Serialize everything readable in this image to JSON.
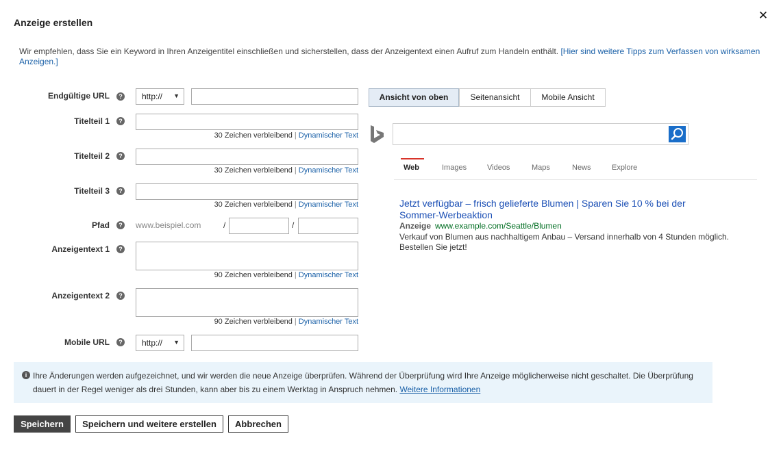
{
  "dialog": {
    "title": "Anzeige erstellen",
    "intro_text": "Wir empfehlen, dass Sie ein Keyword in Ihren Anzeigentitel einschließen und sicherstellen, dass der Anzeigentext einen Aufruf zum Handeln enthält. ",
    "intro_link": "[Hier sind weitere Tipps zum Verfassen von wirksamen Anzeigen.]"
  },
  "form": {
    "final_url": {
      "label": "Endgültige URL",
      "protocol": "http://",
      "value": ""
    },
    "headline1": {
      "label": "Titelteil 1",
      "value": "",
      "counter": "30 Zeichen verbleibend"
    },
    "headline2": {
      "label": "Titelteil 2",
      "value": "",
      "counter": "30 Zeichen verbleibend"
    },
    "headline3": {
      "label": "Titelteil 3",
      "value": "",
      "counter": "30 Zeichen verbleibend"
    },
    "path": {
      "label": "Pfad",
      "prefix": "www.beispiel.com",
      "slash": "/",
      "path1": "",
      "path2": ""
    },
    "desc1": {
      "label": "Anzeigentext 1",
      "value": "",
      "counter": "90 Zeichen verbleibend"
    },
    "desc2": {
      "label": "Anzeigentext 2",
      "value": "",
      "counter": "90 Zeichen verbleibend"
    },
    "mobile_url": {
      "label": "Mobile URL",
      "protocol": "http://",
      "value": ""
    },
    "dynamic_text_link": "Dynamischer Text",
    "separator": "|",
    "help_glyph": "?"
  },
  "preview": {
    "tabs": [
      {
        "label": "Ansicht von oben",
        "active": true
      },
      {
        "label": "Seitenansicht",
        "active": false
      },
      {
        "label": "Mobile Ansicht",
        "active": false
      }
    ],
    "search_value": "",
    "nav": [
      "Web",
      "Images",
      "Videos",
      "Maps",
      "News",
      "Explore"
    ],
    "ad": {
      "title": "Jetzt verfügbar – frisch gelieferte Blumen | Sparen Sie 10 % bei der Sommer-Werbeaktion",
      "badge": "Anzeige",
      "url": "www.example.com/Seattle/Blumen",
      "description": "Verkauf von Blumen aus nachhaltigem Anbau – Versand innerhalb von 4 Stunden möglich. Bestellen Sie jetzt!"
    }
  },
  "notice": {
    "text": "Ihre Änderungen werden aufgezeichnet, und wir werden die neue Anzeige überprüfen. Während der Überprüfung wird Ihre Anzeige möglicherweise nicht geschaltet. Die Überprüfung dauert in der Regel weniger als drei Stunden, kann aber bis zu einem Werktag in Anspruch nehmen. ",
    "link": "Weitere Informationen",
    "icon_glyph": "i"
  },
  "buttons": {
    "save": "Speichern",
    "save_and_new": "Speichern und weitere erstellen",
    "cancel": "Abbrechen"
  },
  "icons": {
    "close": "close-icon",
    "help": "help-icon",
    "dropdown": "chevron-down-icon",
    "search": "search-icon",
    "logo": "bing-logo-icon",
    "info": "info-icon"
  },
  "colors": {
    "link": "#1b61a8",
    "ad_title": "#1b4fb5",
    "ad_url": "#006d21",
    "nav_active_underline": "#d8342a",
    "search_button": "#1a6ec9",
    "notice_bg": "#eaf4fb",
    "primary_button": "#444444"
  }
}
